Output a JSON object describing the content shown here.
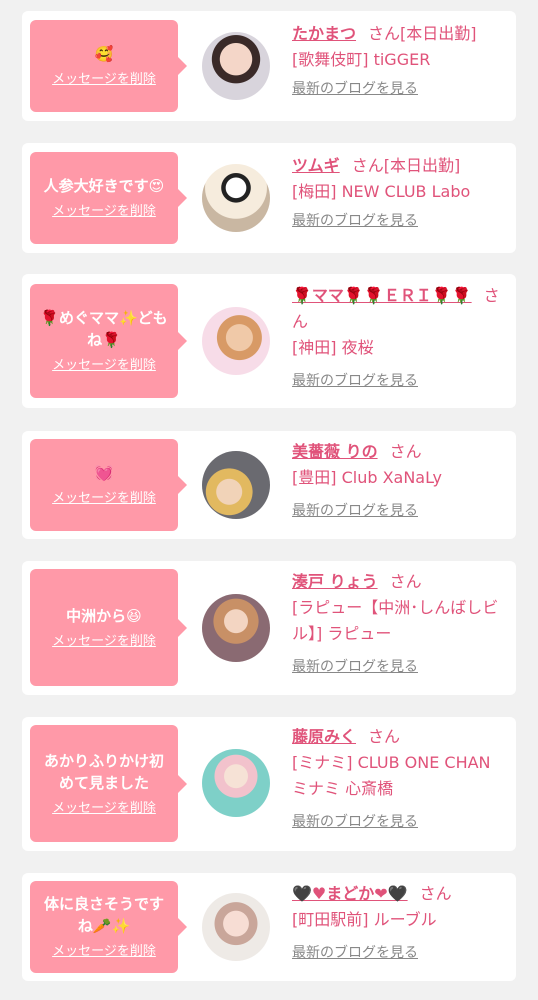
{
  "cards": [
    {
      "message": "🥰",
      "delete_label": "メッセージを削除",
      "name": "たかまつ",
      "san": "さん",
      "status": "[本日出勤]",
      "shop": "[歌舞伎町] tiGGER",
      "blog": "最新のブログを見る"
    },
    {
      "message": "人参大好きです😍",
      "delete_label": "メッセージを削除",
      "name": "ツムギ",
      "san": "さん",
      "status": "[本日出勤]",
      "shop": "[梅田] NEW CLUB Labo",
      "blog": "最新のブログを見る"
    },
    {
      "message": "🌹めぐママ✨どもね🌹",
      "delete_label": "メッセージを削除",
      "name": "🌹ママ🌹🌹ＥＲＩ🌹🌹",
      "san": "さん",
      "status": "",
      "shop": "[神田] 夜桜",
      "blog": "最新のブログを見る"
    },
    {
      "message": "💓",
      "delete_label": "メッセージを削除",
      "name": "美薔薇 りの",
      "san": "さん",
      "status": "",
      "shop": "[豊田] Club XaNaLy",
      "blog": "最新のブログを見る"
    },
    {
      "message": "中洲から😆",
      "delete_label": "メッセージを削除",
      "name": "湊戸 りょう",
      "san": "さん",
      "status": "",
      "shop": "[ラピュー【中洲･しんばしビル】] ラピュー",
      "blog": "最新のブログを見る"
    },
    {
      "message": "あかりふりかけ初めて見ました",
      "delete_label": "メッセージを削除",
      "name": "藤原みく",
      "san": "さん",
      "status": "",
      "shop": "[ミナミ] CLUB ONE CHAN ミナミ 心斎橋",
      "blog": "最新のブログを見る"
    },
    {
      "message": "体に良さそうですね🥕✨",
      "delete_label": "メッセージを削除",
      "name": "🖤♥まどか❤🖤",
      "san": "さん",
      "status": "",
      "shop": "[町田駅前] ルーブル",
      "blog": "最新のブログを見る"
    }
  ],
  "colors": {
    "bubble": "#ff99a8",
    "name": "#e0537a",
    "background": "#f1f1f1"
  },
  "icons": {
    "avatar": "avatar-photo"
  }
}
